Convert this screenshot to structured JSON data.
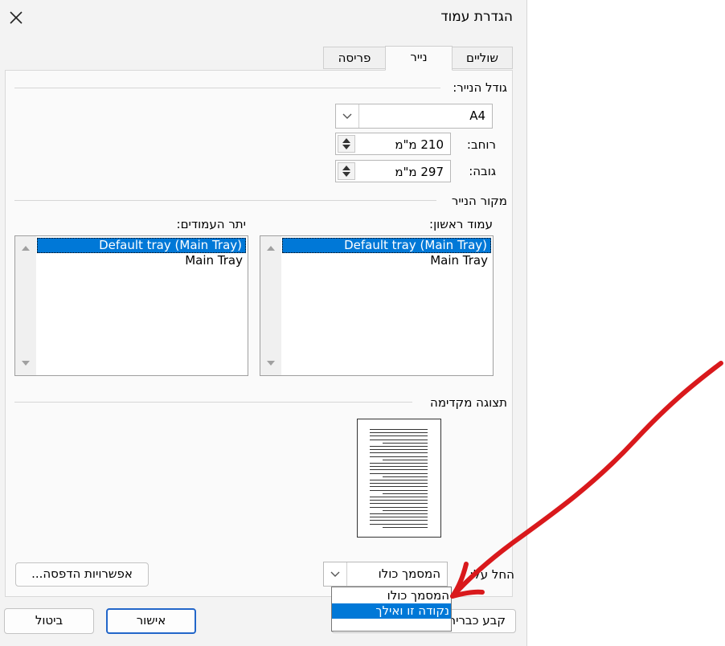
{
  "window": {
    "title": "הגדרת עמוד"
  },
  "tabs": [
    {
      "label": "שוליים"
    },
    {
      "label": "נייר",
      "active": true
    },
    {
      "label": "פריסה"
    }
  ],
  "paper_size": {
    "group_label": "גודל הנייר:",
    "size_value": "A4",
    "width_label": "רוחב:",
    "width_value": "210  מ\"מ",
    "height_label": "גובה:",
    "height_value": "297  מ\"מ"
  },
  "paper_source": {
    "group_label": "מקור הנייר",
    "first_page": {
      "label": "עמוד ראשון:",
      "items": [
        "Default tray (Main Tray)",
        "Main Tray"
      ],
      "selected_index": 0
    },
    "other_pages": {
      "label": "יתר העמודים:",
      "items": [
        "Default tray (Main Tray)",
        "Main Tray"
      ],
      "selected_index": 0
    }
  },
  "preview": {
    "label": "תצוגה מקדימה"
  },
  "apply_to": {
    "label": "החל על:",
    "value": "המסמך כולו",
    "options": [
      "המסמך כולו",
      "נקודה זו ואילך"
    ],
    "highlighted_index": 1
  },
  "buttons": {
    "print_options": "אפשרויות הדפסה...",
    "set_default": "קבע כברירת מחדל",
    "ok": "אישור",
    "cancel": "ביטול"
  },
  "annotation": {
    "color": "#d9191c",
    "shape": "hand-drawn arrow pointing to dropdown option"
  }
}
